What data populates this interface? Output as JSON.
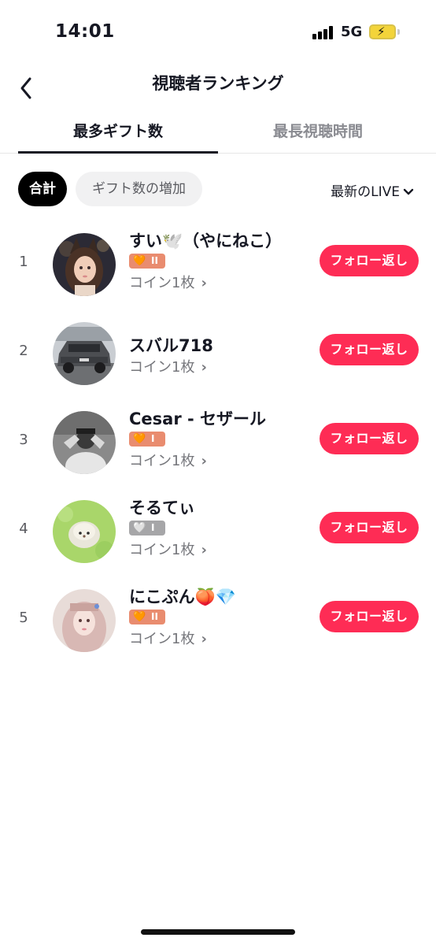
{
  "status_bar": {
    "time": "14:01",
    "network": "5G"
  },
  "header": {
    "title": "視聴者ランキング"
  },
  "tabs": [
    {
      "label": "最多ギフト数",
      "active": true
    },
    {
      "label": "最長視聴時間",
      "active": false
    }
  ],
  "filters": {
    "chips": [
      {
        "label": "合計",
        "active": true
      },
      {
        "label": "ギフト数の増加",
        "active": false
      }
    ],
    "sort_label": "最新のLIVE"
  },
  "viewers": [
    {
      "rank": "1",
      "name": "すい🕊️（やにねこ）",
      "badge_level": "II",
      "badge_color": "#e98c6f",
      "coins": "コイン1枚",
      "action": "フォロー返し",
      "avatar": "anime-girl"
    },
    {
      "rank": "2",
      "name": "スバル718",
      "badge_level": "",
      "coins": "コイン1枚",
      "action": "フォロー返し",
      "avatar": "car"
    },
    {
      "rank": "3",
      "name": "Cesar - セザール",
      "badge_level": "I",
      "badge_color": "#e98c6f",
      "coins": "コイン1枚",
      "action": "フォロー返し",
      "avatar": "man-bw"
    },
    {
      "rank": "4",
      "name": "そるてぃ",
      "badge_level": "I",
      "badge_color": "#a6a6a8",
      "coins": "コイン1枚",
      "action": "フォロー返し",
      "avatar": "hedgehog"
    },
    {
      "rank": "5",
      "name": "にこぷん🍑💎",
      "badge_level": "II",
      "badge_color": "#e98c6f",
      "coins": "コイン1枚",
      "action": "フォロー返し",
      "avatar": "pink-hair-girl"
    }
  ],
  "colors": {
    "accent": "#fe2c55",
    "text_primary": "#161823",
    "text_secondary": "#75767b"
  }
}
